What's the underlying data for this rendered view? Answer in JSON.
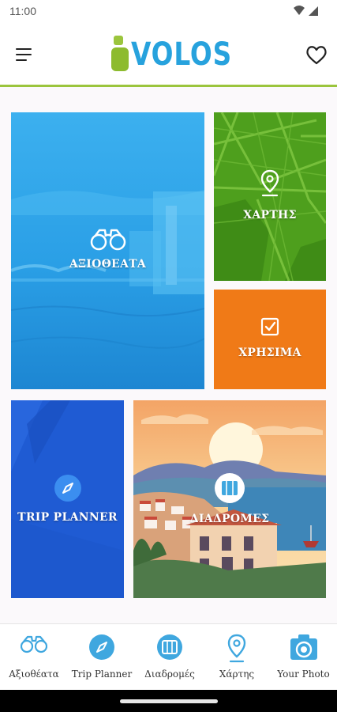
{
  "status_bar": {
    "time": "11:00",
    "wifi_icon": "wifi-icon",
    "signal_icon": "cell-signal-icon"
  },
  "header": {
    "menu_icon": "hamburger-menu-icon",
    "logo_text": "VOLOS",
    "logo_alt": "iVOLOS",
    "favorites_icon": "heart-icon"
  },
  "tiles": [
    {
      "label": "ΑΞΙΟΘΕΑΤΑ",
      "icon": "binoculars-icon",
      "color": "#2fa3e8"
    },
    {
      "label": "ΧΑΡΤΗΣ",
      "icon": "map-pin-icon",
      "color": "#4c9e1c"
    },
    {
      "label": "ΧΡΗΣΙΜΑ",
      "icon": "checkbox-icon",
      "color": "#f07a17"
    },
    {
      "label": "TRIP PLANNER",
      "icon": "compass-icon",
      "color": "#1f5bd3"
    },
    {
      "label": "ΔΙΑΔΡΟΜΕΣ",
      "icon": "folded-map-icon",
      "color": "#f6b57a"
    }
  ],
  "bottom_nav": [
    {
      "label": "Αξιοθέατα",
      "icon": "binoculars-icon"
    },
    {
      "label": "Trip Planner",
      "icon": "compass-icon"
    },
    {
      "label": "Διαδρομές",
      "icon": "folded-map-icon"
    },
    {
      "label": "Χάρτης",
      "icon": "map-pin-icon"
    },
    {
      "label": "Your Photo",
      "icon": "camera-icon"
    }
  ],
  "colors": {
    "accent_blue": "#27a2dd",
    "accent_green": "#9bc53d"
  }
}
